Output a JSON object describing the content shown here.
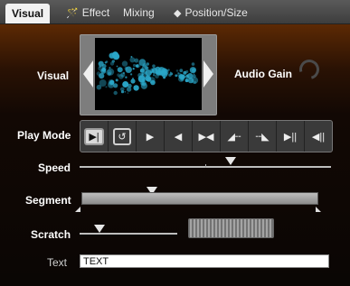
{
  "tabs": [
    {
      "label": "Visual",
      "icon": "none"
    },
    {
      "label": "Effect",
      "icon": "wand-icon"
    },
    {
      "label": "Mixing",
      "icon": "none"
    },
    {
      "label": "Position/Size",
      "icon": "diamond-icon"
    }
  ],
  "labels": {
    "visual": "Visual",
    "audio_gain": "Audio Gain",
    "play_mode": "Play Mode",
    "speed": "Speed",
    "segment": "Segment",
    "scratch": "Scratch",
    "text": "Text"
  },
  "play_modes": [
    {
      "name": "play-forward-once",
      "glyph": "▶|",
      "selected": true
    },
    {
      "name": "loop",
      "glyph": "↺",
      "selected": false
    },
    {
      "name": "play-forward",
      "glyph": "▶",
      "selected": false
    },
    {
      "name": "play-backward",
      "glyph": "◀",
      "selected": false
    },
    {
      "name": "ping-pong",
      "glyph": "▶◀",
      "selected": false
    },
    {
      "name": "ramp-up",
      "glyph": "◢╌",
      "selected": false
    },
    {
      "name": "ramp-down",
      "glyph": "╌◣",
      "selected": false
    },
    {
      "name": "play-pause",
      "glyph": "▶||",
      "selected": false
    },
    {
      "name": "reverse-pause",
      "glyph": "◀||",
      "selected": false
    }
  ],
  "speed": {
    "level": 0.6
  },
  "segment": {
    "position": 0.3
  },
  "scratch": {
    "position": 0.2
  },
  "text_field": {
    "value": "TEXT"
  },
  "colors": {
    "bg_top": "#7a3a08",
    "bg_bottom": "#0a0604",
    "particles": "#2aa6c8"
  }
}
